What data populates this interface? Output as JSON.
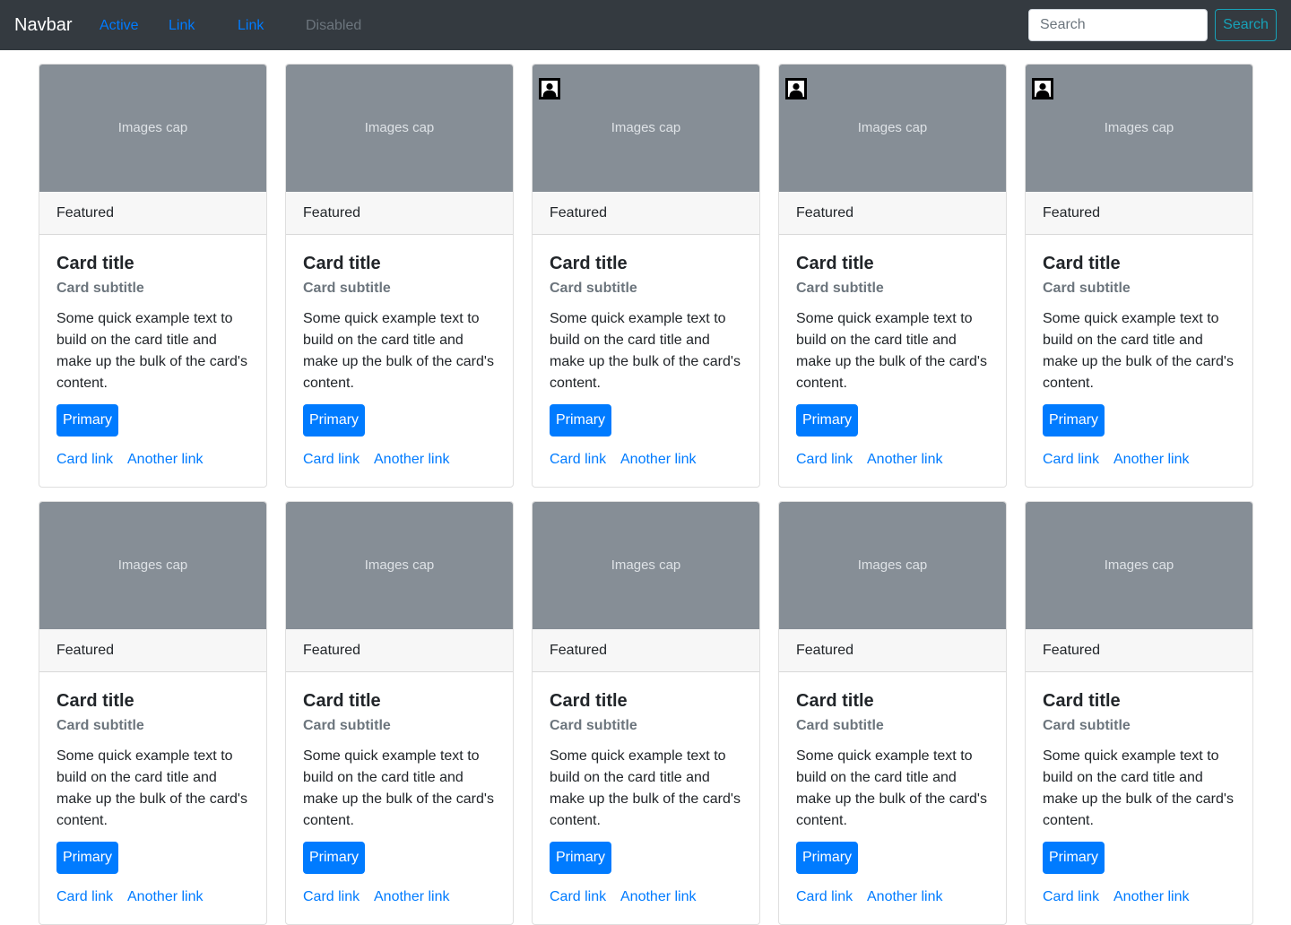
{
  "navbar": {
    "brand": "Navbar",
    "links": [
      {
        "label": "Active",
        "state": "active"
      },
      {
        "label": "Link",
        "state": "default"
      },
      {
        "label": "Link",
        "state": "default"
      },
      {
        "label": "Disabled",
        "state": "disabled"
      }
    ],
    "search_placeholder": "Search",
    "search_button": "Search"
  },
  "cards": [
    {
      "image_label": "Images cap",
      "portrait_icon": false,
      "header": "Featured",
      "title": "Card title",
      "subtitle": "Card subtitle",
      "text": "Some quick example text to build on the card title and make up the bulk of the card's content.",
      "button": "Primary",
      "link_1": "Card link",
      "link_2": "Another link"
    },
    {
      "image_label": "Images cap",
      "portrait_icon": false,
      "header": "Featured",
      "title": "Card title",
      "subtitle": "Card subtitle",
      "text": "Some quick example text to build on the card title and make up the bulk of the card's content.",
      "button": "Primary",
      "link_1": "Card link",
      "link_2": "Another link"
    },
    {
      "image_label": "Images cap",
      "portrait_icon": true,
      "header": "Featured",
      "title": "Card title",
      "subtitle": "Card subtitle",
      "text": "Some quick example text to build on the card title and make up the bulk of the card's content.",
      "button": "Primary",
      "link_1": "Card link",
      "link_2": "Another link"
    },
    {
      "image_label": "Images cap",
      "portrait_icon": true,
      "header": "Featured",
      "title": "Card title",
      "subtitle": "Card subtitle",
      "text": "Some quick example text to build on the card title and make up the bulk of the card's content.",
      "button": "Primary",
      "link_1": "Card link",
      "link_2": "Another link"
    },
    {
      "image_label": "Images cap",
      "portrait_icon": true,
      "header": "Featured",
      "title": "Card title",
      "subtitle": "Card subtitle",
      "text": "Some quick example text to build on the card title and make up the bulk of the card's content.",
      "button": "Primary",
      "link_1": "Card link",
      "link_2": "Another link"
    },
    {
      "image_label": "Images cap",
      "portrait_icon": false,
      "header": "Featured",
      "title": "Card title",
      "subtitle": "Card subtitle",
      "text": "Some quick example text to build on the card title and make up the bulk of the card's content.",
      "button": "Primary",
      "link_1": "Card link",
      "link_2": "Another link"
    },
    {
      "image_label": "Images cap",
      "portrait_icon": false,
      "header": "Featured",
      "title": "Card title",
      "subtitle": "Card subtitle",
      "text": "Some quick example text to build on the card title and make up the bulk of the card's content.",
      "button": "Primary",
      "link_1": "Card link",
      "link_2": "Another link"
    },
    {
      "image_label": "Images cap",
      "portrait_icon": false,
      "header": "Featured",
      "title": "Card title",
      "subtitle": "Card subtitle",
      "text": "Some quick example text to build on the card title and make up the bulk of the card's content.",
      "button": "Primary",
      "link_1": "Card link",
      "link_2": "Another link"
    },
    {
      "image_label": "Images cap",
      "portrait_icon": false,
      "header": "Featured",
      "title": "Card title",
      "subtitle": "Card subtitle",
      "text": "Some quick example text to build on the card title and make up the bulk of the card's content.",
      "button": "Primary",
      "link_1": "Card link",
      "link_2": "Another link"
    },
    {
      "image_label": "Images cap",
      "portrait_icon": false,
      "header": "Featured",
      "title": "Card title",
      "subtitle": "Card subtitle",
      "text": "Some quick example text to build on the card title and make up the bulk of the card's content.",
      "button": "Primary",
      "link_1": "Card link",
      "link_2": "Another link"
    }
  ],
  "colors": {
    "navbar_bg": "#343a40",
    "primary": "#007bff",
    "info": "#17a2b8",
    "muted": "#6c757d",
    "image_placeholder": "#868e96"
  },
  "icons": {
    "portrait": "portrait-icon"
  }
}
